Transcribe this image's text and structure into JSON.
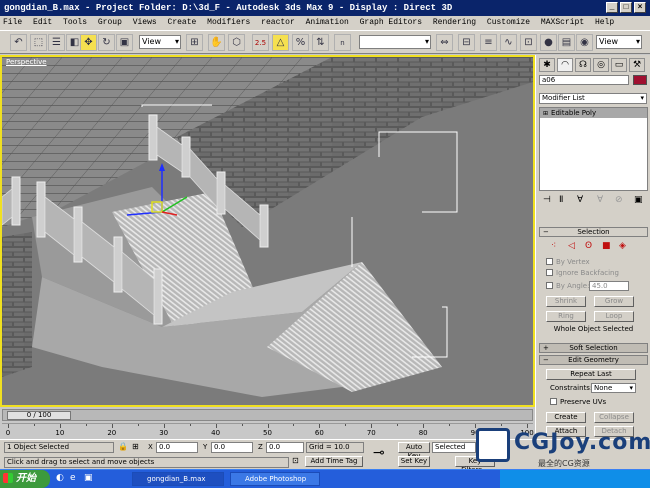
{
  "window": {
    "title": "gongdian_B.max     - Project Folder: D:\\3d_F     - Autodesk 3ds Max 9     - Display : Direct 3D",
    "buttons": [
      "_",
      "□",
      "×"
    ]
  },
  "menu": [
    "File",
    "Edit",
    "Tools",
    "Group",
    "Views",
    "Create",
    "Modifiers",
    "reactor",
    "Animation",
    "Graph Editors",
    "Rendering",
    "Customize",
    "MAXScript",
    "Help"
  ],
  "toolbar": {
    "ref_coord": "View",
    "named_selection": "",
    "view_dropdown": "View",
    "snap_label": "2.5",
    "angle_label": "n"
  },
  "viewport": {
    "label": "Perspective"
  },
  "command_panel": {
    "object_name": "a06",
    "object_color": "#a01030",
    "modifier_list": "Modifier List",
    "stack_item": "Editable Poly",
    "selection_rollout": "Selection",
    "by_vertex": "By Vertex",
    "ignore_backfacing": "Ignore Backfacing",
    "by_angle": "By Angle:",
    "angle_value": "45.0",
    "shrink": "Shrink",
    "grow": "Grow",
    "ring": "Ring",
    "loop": "Loop",
    "selection_status": "Whole Object Selected",
    "soft_selection": "Soft Selection",
    "edit_geometry": "Edit Geometry",
    "repeat_last": "Repeat Last",
    "constraints_label": "Constraints:",
    "constraints_value": "None",
    "preserve_uvs": "Preserve UVs",
    "create": "Create",
    "collapse": "Collapse",
    "attach": "Attach",
    "detach": "Detach"
  },
  "timeline": {
    "frame_display": "0 / 100",
    "ticks": [
      "0",
      "10",
      "20",
      "30",
      "40",
      "50",
      "60",
      "70",
      "80",
      "90",
      "100"
    ]
  },
  "status": {
    "selected": "1 Object Selected",
    "prompt": "Click and drag to select and move objects",
    "x_label": "X",
    "x_value": "0.0",
    "y_label": "Y",
    "y_value": "0.0",
    "z_label": "Z",
    "z_value": "0.0",
    "grid": "Grid = 10.0",
    "add_time_tag": "Add Time Tag",
    "auto_key": "Auto Key",
    "set_key": "Set Key",
    "selected_dropdown": "Selected",
    "key_filters": "Key Filters..."
  },
  "taskbar": {
    "start": "开始",
    "tasks": [
      "gongdian_B.max",
      "Adobe Photoshop"
    ]
  },
  "watermark": {
    "brand": "CGJoy.com",
    "tagline": "最全的CG资源"
  }
}
